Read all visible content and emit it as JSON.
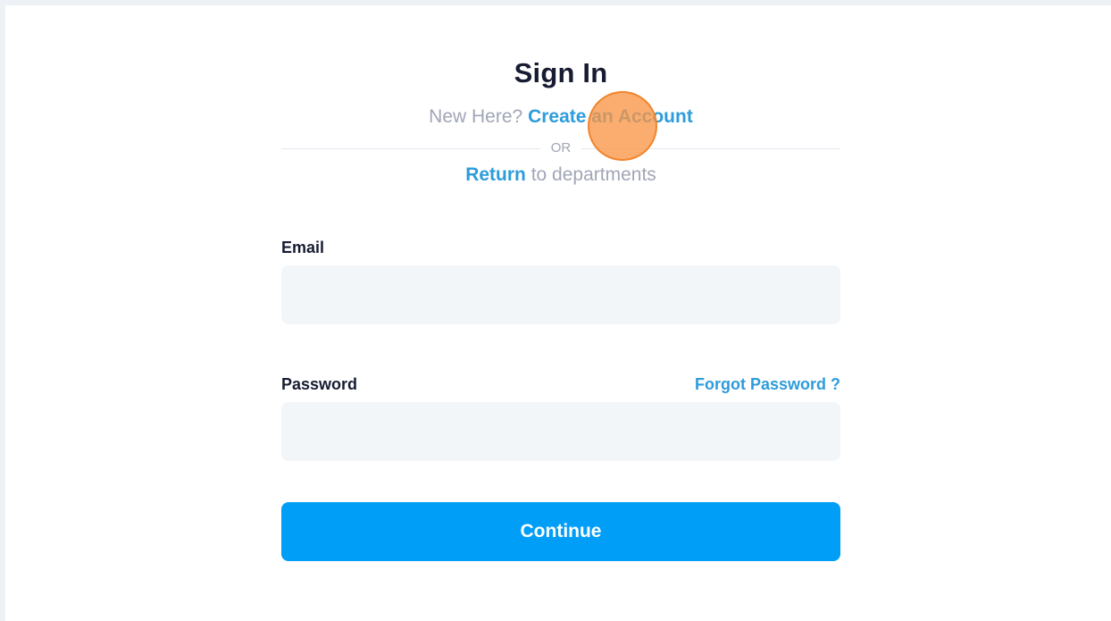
{
  "page": {
    "title": "Sign In",
    "new_here_text": "New Here?",
    "create_account_link": "Create an Account",
    "divider_text": "OR",
    "return_link": "Return",
    "return_suffix": "to departments"
  },
  "form": {
    "email_label": "Email",
    "email_value": "",
    "password_label": "Password",
    "password_value": "",
    "forgot_password_link": "Forgot Password ?",
    "continue_button": "Continue"
  },
  "colors": {
    "accent": "#009ef7",
    "link": "#2d9cdb",
    "heading": "#181c32",
    "muted": "#a1a5b7",
    "input_bg": "#f3f6f9",
    "click_indicator": "#f89646"
  }
}
